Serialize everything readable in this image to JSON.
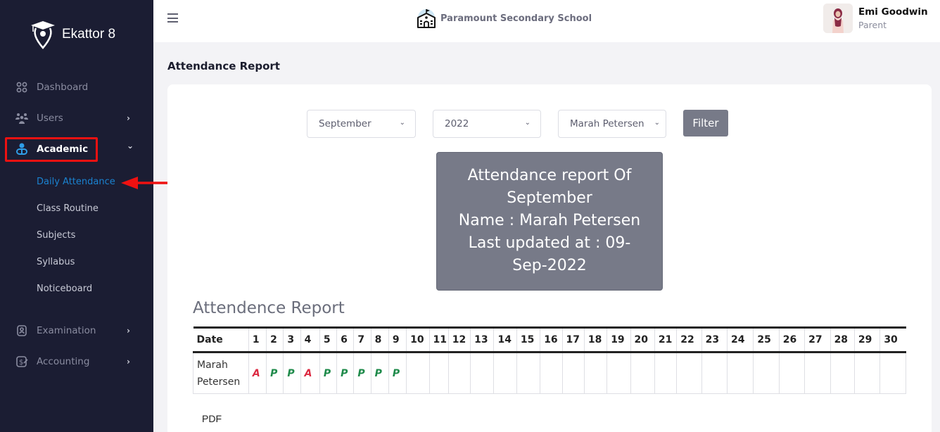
{
  "app": {
    "name": "Ekattor 8"
  },
  "sidebar": {
    "items": [
      {
        "label": "Dashboard",
        "icon": "grid-icon"
      },
      {
        "label": "Users",
        "icon": "users-icon",
        "has_children": true
      },
      {
        "label": "Academic",
        "icon": "academic-icon",
        "has_children": true,
        "expanded": true
      },
      {
        "label": "Examination",
        "icon": "exam-icon",
        "has_children": true
      },
      {
        "label": "Accounting",
        "icon": "accounting-icon",
        "has_children": true
      }
    ],
    "academic_sub": [
      "Daily Attendance",
      "Class Routine",
      "Subjects",
      "Syllabus",
      "Noticeboard"
    ],
    "chevron_right": "›",
    "chevron_down": "⌄"
  },
  "header": {
    "school_name": "Paramount Secondary School",
    "user": {
      "name": "Emi Goodwin",
      "role": "Parent"
    }
  },
  "page": {
    "title": "Attendance Report"
  },
  "filters": {
    "month": "September",
    "year": "2022",
    "student": "Marah Petersen",
    "filter_label": "Filter",
    "chevron": "⌄"
  },
  "report_box": {
    "line1": "Attendance report Of",
    "line2": "September",
    "line3": "Name : Marah Petersen",
    "line4": "Last updated at : 09-",
    "line5": "Sep-2022"
  },
  "table": {
    "title": "Attendence Report",
    "date_header": "Date",
    "days": [
      "1",
      "2",
      "3",
      "4",
      "5",
      "6",
      "7",
      "8",
      "9",
      "10",
      "11",
      "12",
      "13",
      "14",
      "15",
      "16",
      "17",
      "18",
      "19",
      "20",
      "21",
      "22",
      "23",
      "24",
      "25",
      "26",
      "27",
      "28",
      "29",
      "30"
    ],
    "rows": [
      {
        "name_line1": "Marah",
        "name_line2": "Petersen",
        "marks": [
          "A",
          "P",
          "P",
          "A",
          "P",
          "P",
          "P",
          "P",
          "P",
          "",
          "",
          "",
          "",
          "",
          "",
          "",
          "",
          "",
          "",
          "",
          "",
          "",
          "",
          "",
          "",
          "",
          "",
          "",
          "",
          ""
        ]
      }
    ]
  },
  "pdf_label": "PDF",
  "colors": {
    "absent": "#dc2a42",
    "present": "#1e8a4a",
    "active_link": "#1a82d0",
    "highlight": "#ee1111"
  }
}
